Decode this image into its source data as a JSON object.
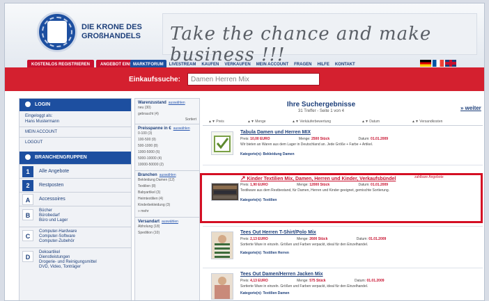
{
  "header": {
    "brand_line1": "DIE KRONE DES",
    "brand_line2": "GROßHANDELS",
    "slogan": "Take the chance and make business !!!"
  },
  "tabs_left": [
    "KOSTENLOS REGISTRIEREN",
    "ANGEBOT EINSTELLEN"
  ],
  "nav": [
    "MARKTFORUM",
    "LIVESTREAM",
    "KAUFEN",
    "VERKAUFEN",
    "MEIN ACCOUNT",
    "FRAGEN",
    "HILFE",
    "KONTAKT"
  ],
  "search": {
    "label": "Einkaufssuche:",
    "value": "Damen Herren Mix"
  },
  "sidebar": {
    "login_head": "LOGIN",
    "login_text1": "Eingeloggt als:",
    "login_text2": "Hans Mustermann",
    "account": "MEIN ACCOUNT",
    "logout": "LOGOUT",
    "groups_head": "BRANCHENGRUPPEN",
    "row1_num": "1",
    "row1_label": "Alle Angebote",
    "row2_num": "2",
    "row2_label": "Restposten",
    "rowA_num": "A",
    "rowA_label": "Accessoires",
    "rowB_num": "B",
    "rowB_l1": "Bücher",
    "rowB_l2": "Bürobedarf",
    "rowB_l3": "Büro und Lager",
    "rowC_num": "C",
    "rowC_l1": "Computer-Hardware",
    "rowC_l2": "Computer-Software",
    "rowC_l3": "Computer-Zubehör",
    "rowD_num": "D",
    "rowD_l1": "Dekoartikel",
    "rowD_l2": "Dienstleistungen",
    "rowD_l3": "Drogerie- und Reinigungsmittel",
    "rowD_l4": "DVD, Video, Tonträger"
  },
  "filters": {
    "block1_title": "Warenzustand",
    "block1_link": "auswählen",
    "block1_l1": "neu (30)",
    "block1_l2": "gebraucht (4)",
    "block1_more": "Sortiert",
    "block2_title": "Preisspanne in €",
    "block2_link": "auswählen",
    "block2_lines": [
      "0-100 (3)",
      "100-500 (9)",
      "500-1000 (8)",
      "1000-5000 (6)",
      "5000-10000 (4)",
      "10000-50000 (2)"
    ],
    "block3_title": "Branchen",
    "block3_link": "auswählen",
    "block3_lines": [
      "Bekleidung Damen (12)",
      "Textilien (8)",
      "Babyartikel (3)",
      "Heimtextilien (4)",
      "Kinderbekleidung (3)"
    ],
    "block3_more": "» mehr",
    "block4_title": "Versandart",
    "block4_link": "auswählen",
    "block4_lines": [
      "Abholung (18)",
      "Spedition (10)"
    ]
  },
  "results": {
    "title": "Ihre Suchergebnisse",
    "subtitle": "31 Treffer - Seite 1 von 4",
    "next": "» weiter",
    "sort": [
      "Preis",
      "Menge",
      "Verkäuferbewertung",
      "Datum",
      "Versandkosten"
    ]
  },
  "items": [
    {
      "title": "Tabula Damen und Herren MIX",
      "price_label": "Preis:",
      "price": "10,00 EURO",
      "qty_label": "Menge:",
      "qty": "2500 Stück",
      "date_label": "Datum:",
      "date": "01.01.2009",
      "desc": "Wir bieten an Waren aus dem Lager in Deutschland an. Jede Größe + Farbe + Artikel.",
      "category": "Kategorie(n): Bekleidung Damen"
    },
    {
      "title": "Kinder Textilien Mix, Damen, Herren und Kinder, Verkaufsbündel",
      "badge": "zahlbare Angebote",
      "price_label": "Preis:",
      "price": "1,90 EURO",
      "qty_label": "Menge:",
      "qty": "12000 Stück",
      "date_label": "Datum:",
      "date": "01.01.2009",
      "desc": "Textilware aus dem Restbestand, für Damen, Herren und Kinder geeignet, gemischte Sortierung.",
      "category": "Kategorie(n): Textilien"
    },
    {
      "title": "Tees Out Herren T-Shirt/Polo Mix",
      "price_label": "Preis:",
      "price": "2,13 EURO",
      "qty_label": "Menge:",
      "qty": "2600 Stück",
      "date_label": "Datum:",
      "date": "01.01.2009",
      "desc": "Sortierte Ware in einzeln. Größen und Farben verpackt, ideal für den Einzelhandel.",
      "category": "Kategorie(n): Textilien Herren"
    },
    {
      "title": "Tees Out Damen/Herren Jacken Mix",
      "price_label": "Preis:",
      "price": "4,13 EURO",
      "qty_label": "Menge:",
      "qty": "575 Stück",
      "date_label": "Datum:",
      "date": "01.01.2009",
      "desc": "Sortierte Ware in einzeln. Größen und Farben verpackt, ideal für den Einzelhandel.",
      "category": "Kategorie(n): Textilien Damen"
    }
  ]
}
